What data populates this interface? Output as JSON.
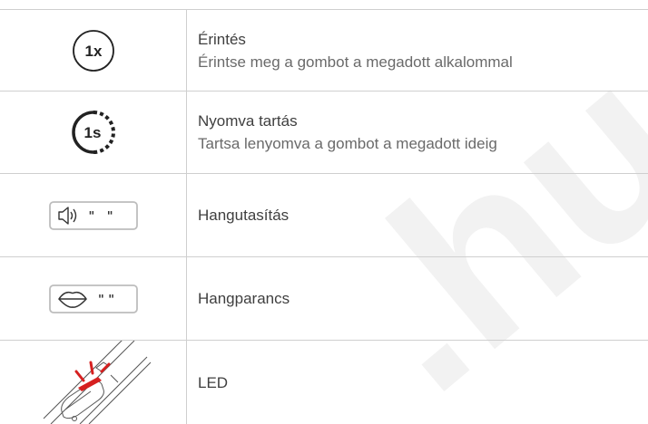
{
  "rows": [
    {
      "icon": "tap-1x-icon",
      "icon_text": "1x",
      "title": "Érintés",
      "description": "Érintse meg a gombot a megadott alkalommal"
    },
    {
      "icon": "press-hold-1s-icon",
      "icon_text": "1s",
      "title": "Nyomva tartás",
      "description": "Tartsa lenyomva a gombot a megadott ideig"
    },
    {
      "icon": "speaker-prompt-icon",
      "icon_text": "\"   \"",
      "title": "Hangutasítás",
      "description": ""
    },
    {
      "icon": "lips-voice-command-icon",
      "icon_text": "\" \"",
      "title": "Hangparancs",
      "description": ""
    },
    {
      "icon": "led-device-icon",
      "icon_text": "",
      "title": "LED",
      "description": ""
    }
  ],
  "watermark_text": ".hu",
  "colors": {
    "border": "#cfcfcf",
    "icon_stroke": "#222222",
    "box_stroke": "#bdbdbd",
    "led_red": "#d62020",
    "watermark": "#f2f2f2"
  }
}
